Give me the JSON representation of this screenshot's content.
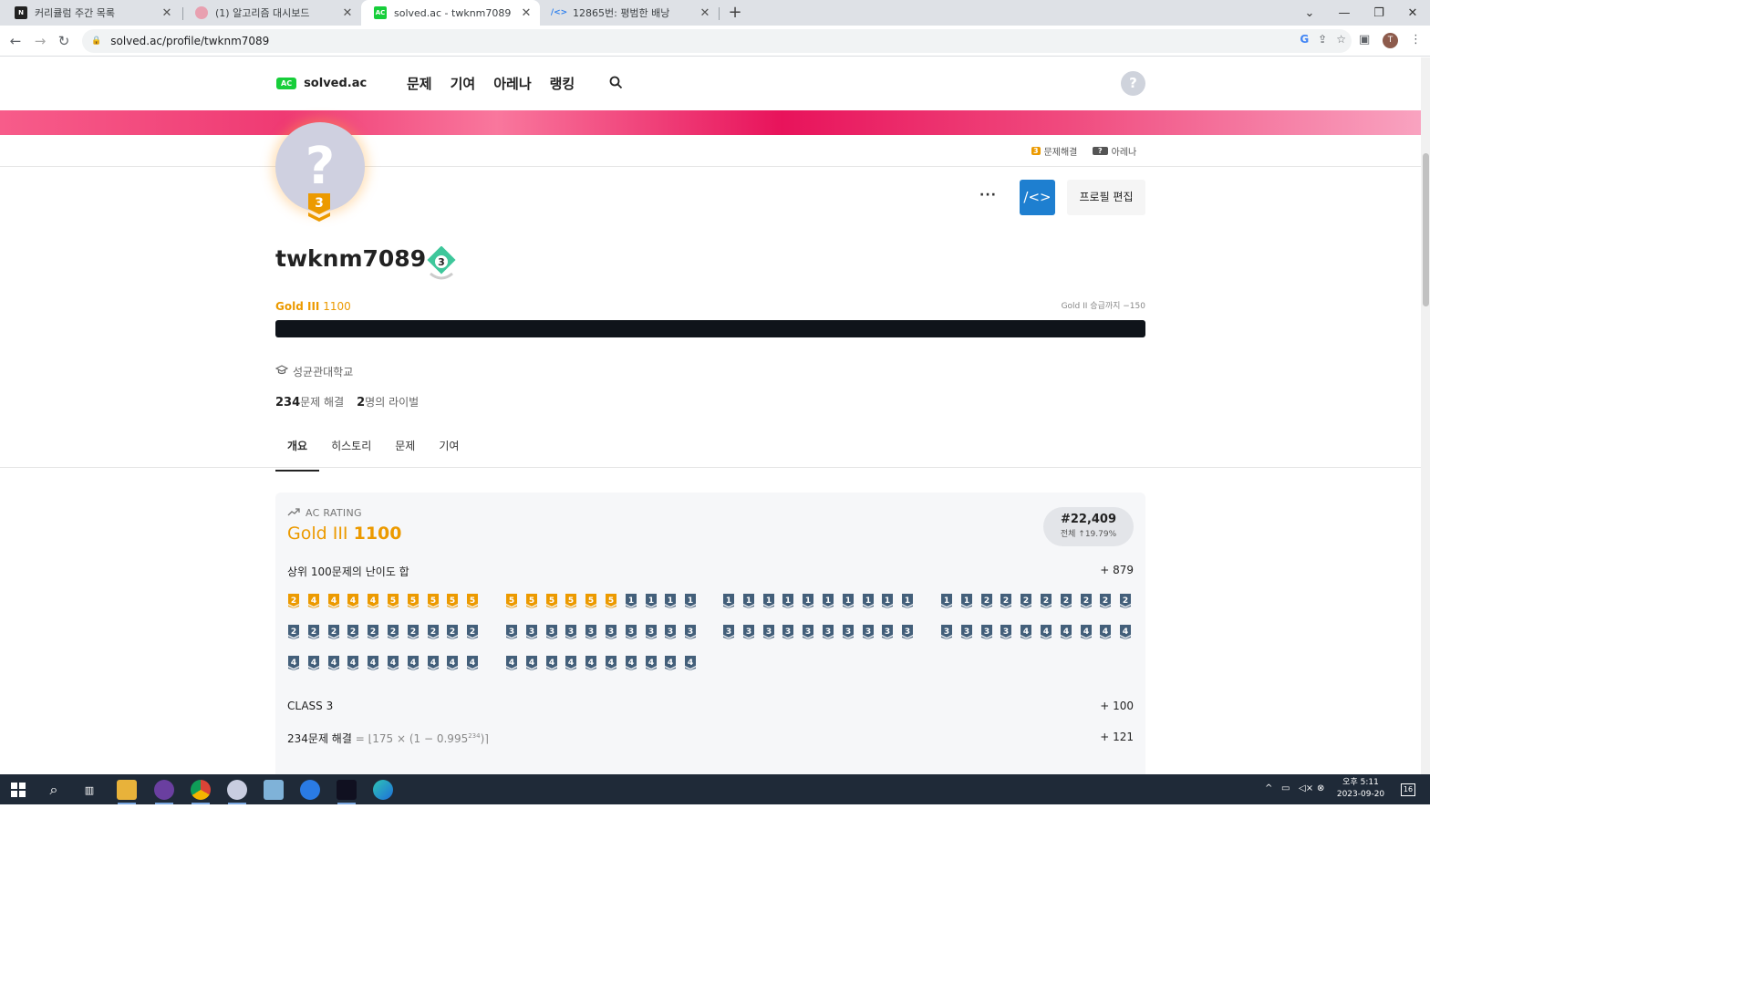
{
  "browser": {
    "tabs": [
      {
        "title": "커리큘럼 주간 목록",
        "icon": "notion-icon",
        "color": "#222222"
      },
      {
        "title": "(1) 알고리즘 대시보드",
        "icon": "brain-icon",
        "color": "#e8a0b0"
      },
      {
        "title": "solved.ac - twknm7089",
        "icon": "solvedac-icon",
        "color": "#17ce3a"
      },
      {
        "title": "12865번: 평범한 배낭",
        "icon": "boj-icon",
        "color": "#2f80ed"
      }
    ],
    "url": "solved.ac/profile/twknm7089",
    "profile_initial": "T"
  },
  "site": {
    "logo_badge": "AC",
    "logo_text": "solved.ac",
    "nav": [
      "문제",
      "기여",
      "아레나",
      "랭킹"
    ],
    "help": "?"
  },
  "ribbon": {
    "solved_badge": "3",
    "solved_label": "문제해결",
    "arena_badge": "?",
    "arena_label": "아레나"
  },
  "profile": {
    "avatar_glyph": "?",
    "tier_level": "3",
    "username": "twknm7089",
    "class_level": "3",
    "more": "···",
    "edit_label": "프로필 편집",
    "tier_name": "Gold III",
    "rating": "1100",
    "next_tier": "Gold II 승급까지 −150",
    "organization": "성균관대학교",
    "solved_count": "234",
    "solved_suffix": "문제 해결",
    "rival_count": "2",
    "rival_suffix": "명의 라이벌"
  },
  "profile_tabs": [
    "개요",
    "히스토리",
    "문제",
    "기여"
  ],
  "rating_card": {
    "label": "AC RATING",
    "tier": "Gold III",
    "rating": "1100",
    "rank": "#22,409",
    "rank_percent": "전체 ↑19.79%",
    "top100_label": "상위 100문제의 난이도 합",
    "top100_value": "+ 879",
    "class_label": "CLASS 3",
    "class_value": "+ 100",
    "solved_label": "234문제 해결",
    "solved_formula": "= ⌊175 × (1 − 0.995",
    "solved_exponent": "234",
    "solved_formula_end": ")⌉",
    "solved_value": "+ 121"
  },
  "difficulty_grid": [
    [
      "g2",
      "g4",
      "g4",
      "g4",
      "g4",
      "g5",
      "g5",
      "g5",
      "g5",
      "g5",
      "g5",
      "g5",
      "g5",
      "g5",
      "g5",
      "g5",
      "s1",
      "s1",
      "s1",
      "s1",
      "s1",
      "s1",
      "s1",
      "s1",
      "s1",
      "s1",
      "s1",
      "s1",
      "s1",
      "s1",
      "s1",
      "s1",
      "s2",
      "s2",
      "s2",
      "s2",
      "s2",
      "s2",
      "s2",
      "s2"
    ],
    [
      "s2",
      "s2",
      "s2",
      "s2",
      "s2",
      "s2",
      "s2",
      "s2",
      "s2",
      "s2",
      "s3",
      "s3",
      "s3",
      "s3",
      "s3",
      "s3",
      "s3",
      "s3",
      "s3",
      "s3",
      "s3",
      "s3",
      "s3",
      "s3",
      "s3",
      "s3",
      "s3",
      "s3",
      "s3",
      "s3",
      "s3",
      "s3",
      "s3",
      "s3",
      "s4",
      "s4",
      "s4",
      "s4",
      "s4",
      "s4"
    ],
    [
      "s4",
      "s4",
      "s4",
      "s4",
      "s4",
      "s4",
      "s4",
      "s4",
      "s4",
      "s4",
      "s4",
      "s4",
      "s4",
      "s4",
      "s4",
      "s4",
      "s4",
      "s4",
      "s4",
      "s4"
    ]
  ],
  "tier_colors": {
    "gold": "#ec9a00",
    "silver": "#435f7a"
  },
  "taskbar": {
    "clock_time": "오후 5:11",
    "clock_date": "2023-09-20",
    "notifications": "16"
  }
}
